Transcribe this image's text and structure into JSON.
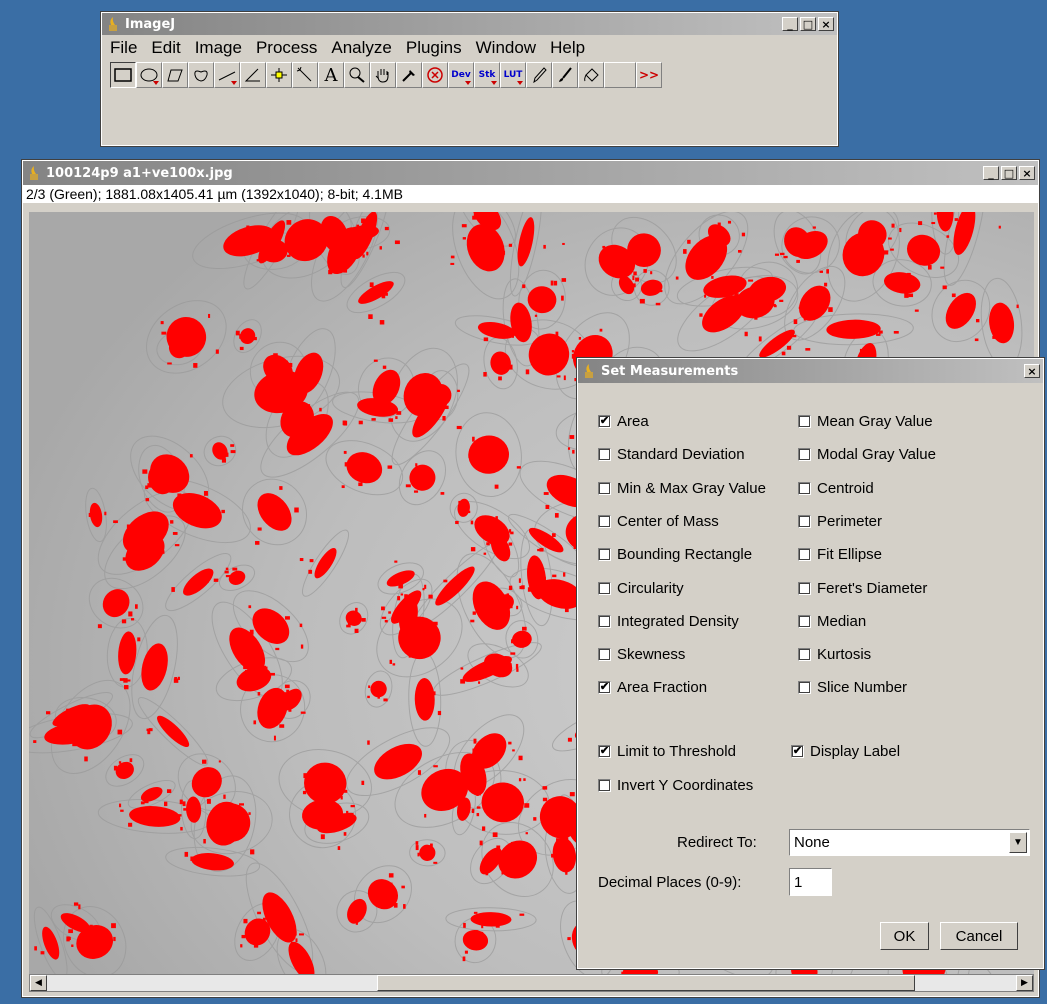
{
  "imagej": {
    "title": "ImageJ",
    "menu": [
      "File",
      "Edit",
      "Image",
      "Process",
      "Analyze",
      "Plugins",
      "Window",
      "Help"
    ],
    "tools": [
      "rectangle",
      "oval",
      "polygon",
      "freehand",
      "line",
      "angle",
      "point",
      "wand",
      "text",
      "magnifier",
      "scroll",
      "color-picker",
      "stop",
      "Dev",
      "Stk",
      "LUT",
      "pencil",
      "brush",
      "flood-fill",
      "blank",
      "more"
    ]
  },
  "image_window": {
    "title": "100124p9 a1+ve100x.jpg",
    "info": "2/3 (Green); 1881.08x1405.41 µm (1392x1040); 8-bit; 4.1MB"
  },
  "dialog": {
    "title": "Set Measurements",
    "left_options": [
      {
        "label": "Area",
        "checked": true
      },
      {
        "label": "Standard Deviation",
        "checked": false
      },
      {
        "label": "Min & Max Gray Value",
        "checked": false
      },
      {
        "label": "Center of Mass",
        "checked": false
      },
      {
        "label": "Bounding Rectangle",
        "checked": false
      },
      {
        "label": "Circularity",
        "checked": false
      },
      {
        "label": "Integrated Density",
        "checked": false
      },
      {
        "label": "Skewness",
        "checked": false
      },
      {
        "label": "Area Fraction",
        "checked": true
      }
    ],
    "right_options": [
      {
        "label": "Mean Gray Value",
        "checked": false
      },
      {
        "label": "Modal Gray Value",
        "checked": false
      },
      {
        "label": "Centroid",
        "checked": false
      },
      {
        "label": "Perimeter",
        "checked": false
      },
      {
        "label": "Fit Ellipse",
        "checked": false
      },
      {
        "label": "Feret's Diameter",
        "checked": false
      },
      {
        "label": "Median",
        "checked": false
      },
      {
        "label": "Kurtosis",
        "checked": false
      },
      {
        "label": "Slice Number",
        "checked": false
      }
    ],
    "limit_to_threshold": {
      "label": "Limit to Threshold",
      "checked": true
    },
    "display_label": {
      "label": "Display Label",
      "checked": true
    },
    "invert_y": {
      "label": "Invert Y Coordinates",
      "checked": false
    },
    "redirect_label": "Redirect To:",
    "redirect_value": "None",
    "decimal_label": "Decimal Places (0-9):",
    "decimal_value": "1",
    "ok": "OK",
    "cancel": "Cancel"
  },
  "colors": {
    "overlay": "#ff0000",
    "desktop": "#3a6ea5",
    "chrome": "#d4d0c8"
  }
}
